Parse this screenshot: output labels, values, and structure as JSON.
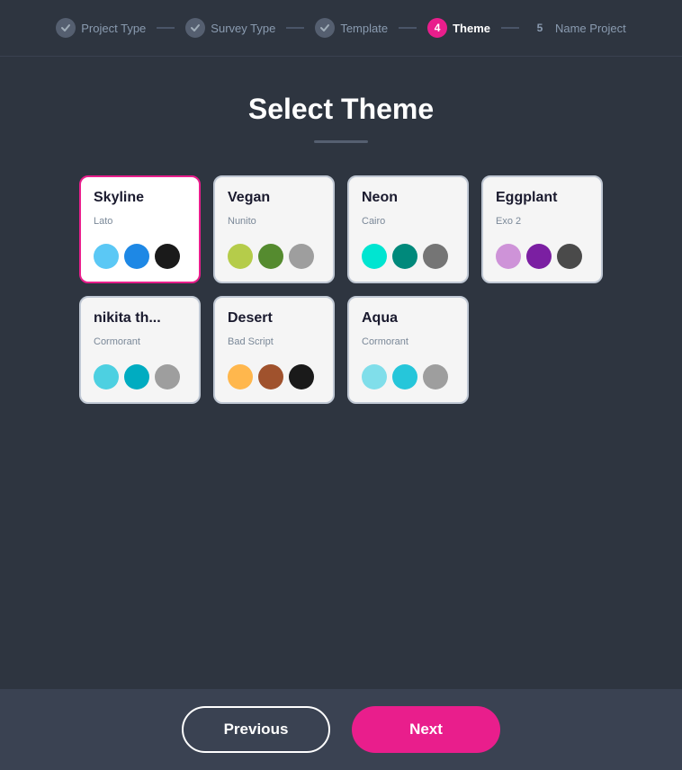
{
  "stepper": {
    "steps": [
      {
        "id": "project-type",
        "label": "Project Type",
        "status": "completed",
        "number": "✓"
      },
      {
        "id": "survey-type",
        "label": "Survey Type",
        "status": "completed",
        "number": "✓"
      },
      {
        "id": "template",
        "label": "Template",
        "status": "completed",
        "number": "✓"
      },
      {
        "id": "theme",
        "label": "Theme",
        "status": "active",
        "number": "4"
      },
      {
        "id": "name-project",
        "label": "Name Project",
        "status": "inactive",
        "number": "5"
      }
    ]
  },
  "page": {
    "title": "Select Theme",
    "divider": true
  },
  "themes": [
    {
      "id": "skyline",
      "name": "Skyline",
      "font": "Lato",
      "selected": true,
      "colors": [
        "#5bc8f5",
        "#1e88e5",
        "#1a1a1a"
      ]
    },
    {
      "id": "vegan",
      "name": "Vegan",
      "font": "Nunito",
      "selected": false,
      "colors": [
        "#b5cc4a",
        "#558b2f",
        "#9e9e9e"
      ]
    },
    {
      "id": "neon",
      "name": "Neon",
      "font": "Cairo",
      "selected": false,
      "colors": [
        "#00e5d1",
        "#00897b",
        "#757575"
      ]
    },
    {
      "id": "eggplant",
      "name": "Eggplant",
      "font": "Exo 2",
      "selected": false,
      "colors": [
        "#ce93d8",
        "#7b1fa2",
        "#4a4a4a"
      ]
    },
    {
      "id": "nikita",
      "name": "nikita th...",
      "font": "Cormorant",
      "selected": false,
      "colors": [
        "#4dd0e1",
        "#00acc1",
        "#9e9e9e"
      ]
    },
    {
      "id": "desert",
      "name": "Desert",
      "font": "Bad Script",
      "selected": false,
      "colors": [
        "#ffb74d",
        "#a0522d",
        "#1a1a1a"
      ]
    },
    {
      "id": "aqua",
      "name": "Aqua",
      "font": "Cormorant",
      "selected": false,
      "colors": [
        "#80deea",
        "#26c6da",
        "#9e9e9e"
      ]
    }
  ],
  "buttons": {
    "previous": "Previous",
    "next": "Next"
  }
}
